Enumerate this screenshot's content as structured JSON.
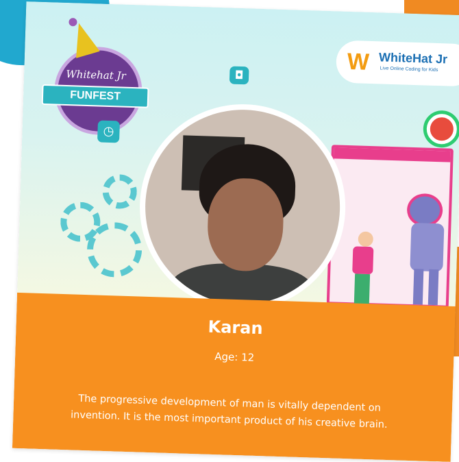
{
  "funfest_logo": {
    "script_text": "Whitehat Jr",
    "banner_text": "FUNFEST"
  },
  "brand_logo": {
    "name": "WhiteHat Jr",
    "tagline": "Live Online Coding for Kids"
  },
  "student": {
    "name": "Karan",
    "age": "Age: 12"
  },
  "quote": "The progressive development of man is vitally dependent on invention. It is the most important product of his creative brain.",
  "colors": {
    "card_top": "#ccf1f3",
    "card_bottom": "#f7901f",
    "accent_teal": "#2bb3bf",
    "accent_purple": "#6b3b91",
    "accent_pink": "#e83e8c"
  },
  "icons": [
    "party-hat-icon",
    "clock-icon",
    "gamepad-icon",
    "gear-icon",
    "target-icon",
    "robot-icon"
  ]
}
